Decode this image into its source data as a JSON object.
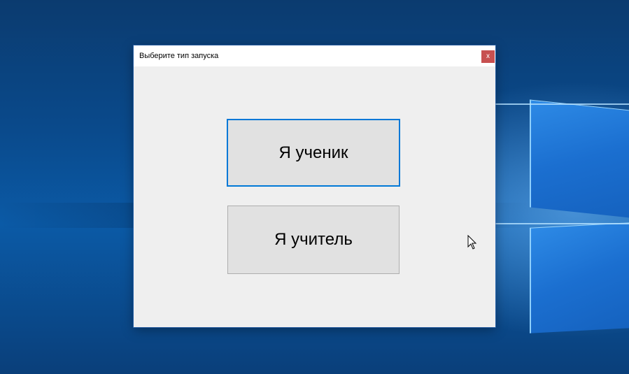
{
  "dialog": {
    "title": "Выберите тип запуска",
    "close_label": "x",
    "buttons": {
      "student": "Я ученик",
      "teacher": "Я учитель"
    }
  },
  "icons": {
    "close": "close-icon",
    "cursor": "mouse-pointer-icon"
  },
  "colors": {
    "accent": "#0078d7",
    "close_button": "#c75050",
    "dialog_bg": "#efefef",
    "button_bg": "#e1e1e1"
  }
}
